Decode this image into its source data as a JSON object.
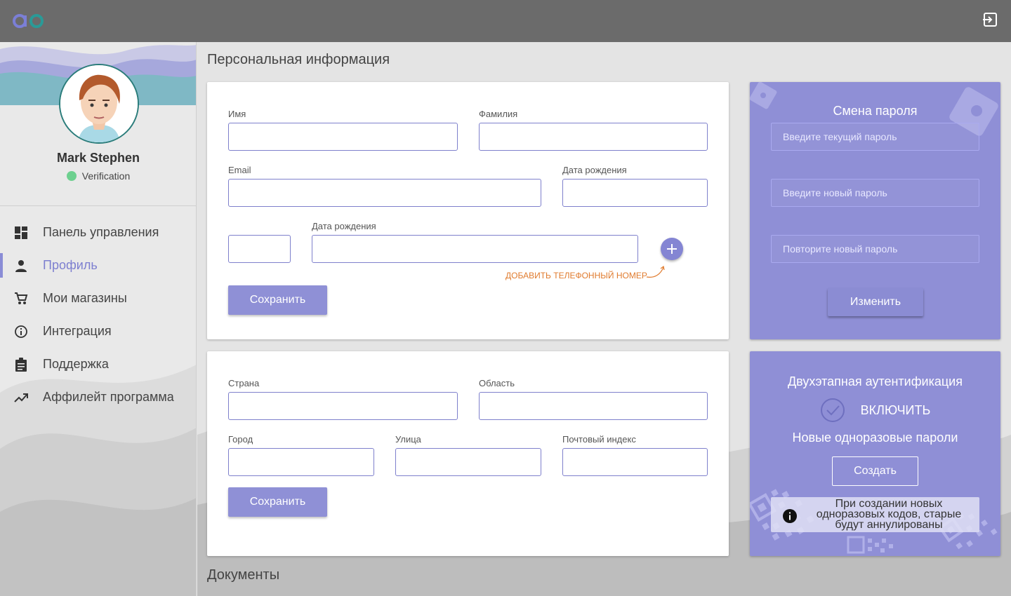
{
  "header": {
    "logo_icon": "ab-logo-icon",
    "logout_icon": "logout-icon"
  },
  "sidebar": {
    "user_name": "Mark Stephen",
    "status_label": "Verification",
    "status_color": "#6dd08f",
    "items": [
      {
        "label": "Панель управления",
        "icon": "dashboard-icon",
        "active": false
      },
      {
        "label": "Профиль",
        "icon": "person-icon",
        "active": true
      },
      {
        "label": "Мои магазины",
        "icon": "cart-icon",
        "active": false
      },
      {
        "label": "Интеграция",
        "icon": "info-icon",
        "active": false
      },
      {
        "label": "Поддержка",
        "icon": "clipboard-icon",
        "active": false
      },
      {
        "label": "Аффилейт программа",
        "icon": "trending-up-icon",
        "active": false
      }
    ]
  },
  "personal_info": {
    "title": "Персональная информация",
    "first_name_label": "Имя",
    "last_name_label": "Фамилия",
    "email_label": "Email",
    "birthdate_label": "Дата рождения",
    "phone_label": "Дата рождения",
    "add_phone_label": "ДОБАВИТЬ ТЕЛЕФОННЫЙ НОМЕР",
    "save_label": "Сохранить"
  },
  "address": {
    "country_label": "Страна",
    "region_label": "Область",
    "city_label": "Город",
    "street_label": "Улица",
    "postal_label": "Почтовый индекс",
    "save_label": "Сохранить"
  },
  "documents": {
    "title": "Документы"
  },
  "password_change": {
    "title": "Смена пароля",
    "current_placeholder": "Введите текущий пароль",
    "new_placeholder": "Введите новый пароль",
    "repeat_placeholder": "Повторите новый пароль",
    "change_label": "Изменить"
  },
  "two_factor": {
    "title": "Двухэтапная аутентификация",
    "enable_label": "ВКЛЮЧИТЬ",
    "otp_title": "Новые одноразовые пароли",
    "create_label": "Создать",
    "note": "При создании новых одноразовых кодов, старые будут аннулированы"
  },
  "colors": {
    "accent": "#8f90d6",
    "topbar": "#6b6b6b",
    "orange_hint": "#e07b2e"
  }
}
